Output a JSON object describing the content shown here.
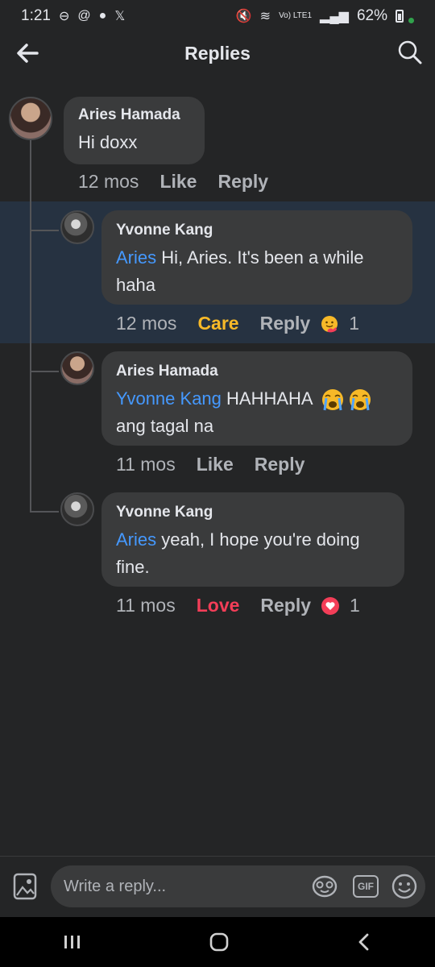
{
  "status": {
    "time": "1:21",
    "battery": "62%",
    "network": "Vo) LTE1"
  },
  "header": {
    "title": "Replies"
  },
  "comments": [
    {
      "author": "Aries Hamada",
      "mention": "",
      "text": "Hi doxx",
      "time": "12 mos",
      "reaction_label": "Like",
      "reply_label": "Reply",
      "reaction_count": ""
    },
    {
      "author": "Yvonne Kang",
      "mention": "Aries",
      "text": " Hi, Aries. It's been a while haha",
      "time": "12 mos",
      "reaction_label": "Care",
      "reply_label": "Reply",
      "reaction_count": "1"
    },
    {
      "author": "Aries Hamada",
      "mention": "Yvonne Kang",
      "text": " HAHHAHA ",
      "text2": "ang tagal na",
      "time": "11 mos",
      "reaction_label": "Like",
      "reply_label": "Reply",
      "reaction_count": ""
    },
    {
      "author": "Yvonne Kang",
      "mention": "Aries",
      "text": " yeah, I hope you're doing fine.",
      "time": "11 mos",
      "reaction_label": "Love",
      "reply_label": "Reply",
      "reaction_count": "1"
    }
  ],
  "composer": {
    "placeholder": "Write a reply...",
    "gif_label": "GIF"
  },
  "icons": {
    "back": "back-arrow-icon",
    "search": "search-icon",
    "photo": "photo-icon",
    "sticker": "sticker-icon",
    "gif": "gif-icon",
    "emoji": "emoji-icon"
  },
  "colors": {
    "background": "#242526",
    "bubble": "#3a3b3c",
    "mention": "#4599ff",
    "care": "#f7b928",
    "love": "#f33e58",
    "highlight": "#263241"
  }
}
